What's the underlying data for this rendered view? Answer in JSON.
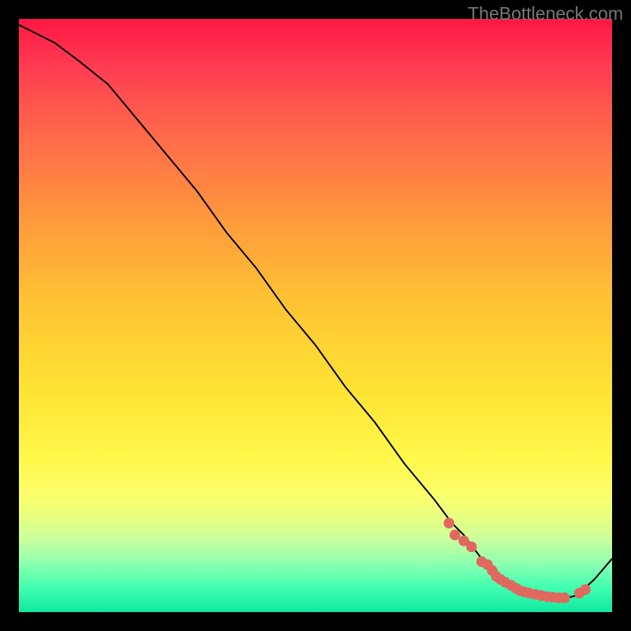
{
  "watermark": "TheBottleneck.com",
  "chart_data": {
    "type": "line",
    "title": "",
    "xlabel": "",
    "ylabel": "",
    "xlim": [
      0,
      100
    ],
    "ylim": [
      0,
      100
    ],
    "series": [
      {
        "name": "curve",
        "x": [
          0,
          6,
          10,
          15,
          20,
          25,
          30,
          35,
          40,
          45,
          50,
          55,
          60,
          65,
          70,
          73,
          75,
          78,
          80,
          82,
          84,
          86,
          88,
          90,
          92,
          94,
          97,
          100
        ],
        "y": [
          99,
          96,
          93,
          89,
          83,
          77,
          71,
          64,
          58,
          51,
          45,
          38,
          32,
          25,
          19,
          15,
          13,
          9,
          7,
          5,
          4,
          3.2,
          2.6,
          2.3,
          2.3,
          2.8,
          5.5,
          9
        ]
      }
    ],
    "scatter": {
      "name": "dots",
      "x": [
        72.5,
        73.5,
        75.0,
        76.3,
        78.0,
        79.0,
        79.8,
        80.5,
        81.2,
        82.0,
        83.0,
        83.8,
        84.5,
        85.2,
        86.0,
        87.0,
        88.0,
        89.0,
        90.0,
        91.0,
        92.0,
        94.5,
        95.5
      ],
      "y": [
        15.0,
        13.0,
        12.0,
        11.0,
        8.5,
        8.0,
        7.0,
        6.0,
        5.5,
        5.0,
        4.5,
        4.0,
        3.6,
        3.4,
        3.2,
        3.0,
        2.8,
        2.6,
        2.5,
        2.4,
        2.4,
        3.2,
        3.8
      ]
    },
    "colors": {
      "curve": "#000000",
      "dots": "#e0695f"
    }
  }
}
